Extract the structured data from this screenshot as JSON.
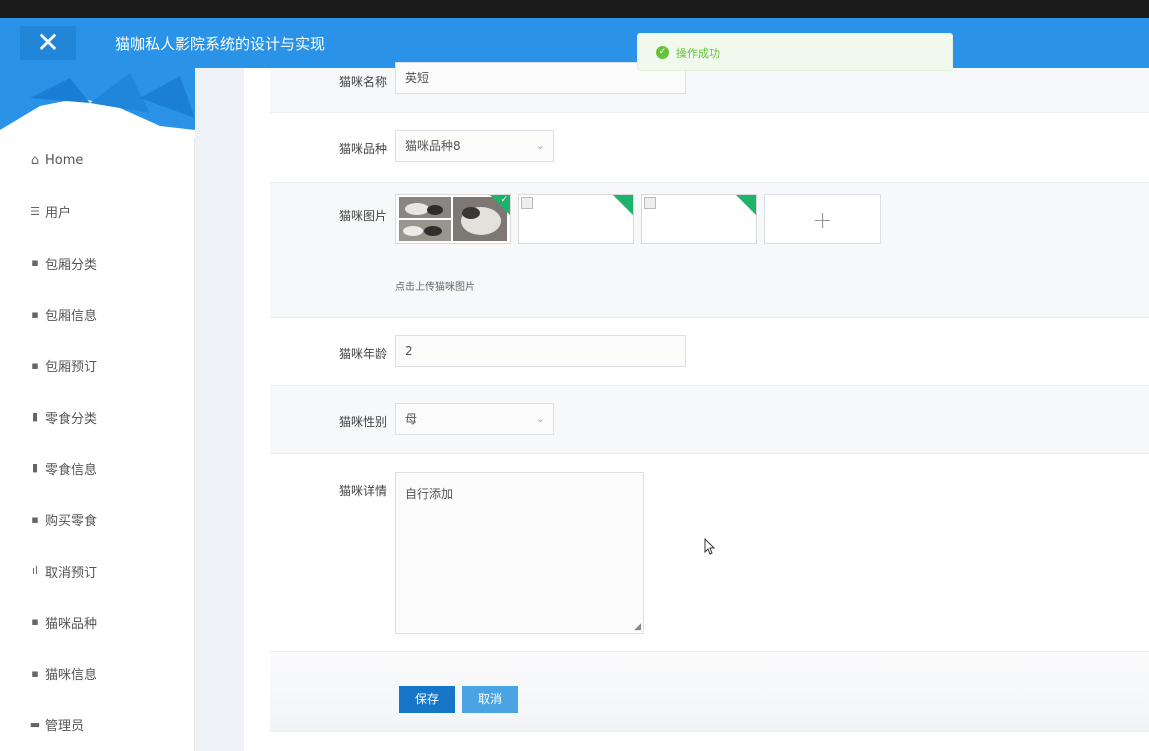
{
  "header": {
    "close_glyph": "✕",
    "title": "猫咖私人影院系统的设计与实现"
  },
  "toast": {
    "icon": "check-circle-icon",
    "message": "操作成功",
    "color": "#67c23a"
  },
  "sidebar": {
    "items": [
      {
        "icon": "home-icon",
        "glyph": "⌂",
        "label": "Home"
      },
      {
        "icon": "list-icon",
        "glyph": "☰",
        "label": "用户"
      },
      {
        "icon": "grid-icon",
        "glyph": "▪",
        "label": "包厢分类"
      },
      {
        "icon": "grid-icon",
        "glyph": "▪",
        "label": "包厢信息"
      },
      {
        "icon": "grid-icon",
        "glyph": "▪",
        "label": "包厢预订"
      },
      {
        "icon": "chart-icon",
        "glyph": "▮",
        "label": "零食分类"
      },
      {
        "icon": "thumb-icon",
        "glyph": "▮",
        "label": "零食信息"
      },
      {
        "icon": "bag-icon",
        "glyph": "▪",
        "label": "购买零食"
      },
      {
        "icon": "bar-chart-icon",
        "glyph": "ıl",
        "label": "取消预订"
      },
      {
        "icon": "grid-icon",
        "glyph": "▪",
        "label": "猫咪品种"
      },
      {
        "icon": "grid-icon",
        "glyph": "▪",
        "label": "猫咪信息"
      },
      {
        "icon": "monitor-icon",
        "glyph": "▬",
        "label": "管理员"
      }
    ]
  },
  "form": {
    "name": {
      "label": "猫咪名称",
      "value": "英短"
    },
    "breed": {
      "label": "猫咪品种",
      "value": "猫咪品种8"
    },
    "images": {
      "label": "猫咪图片",
      "hint": "点击上传猫咪图片",
      "add_glyph": "+"
    },
    "age": {
      "label": "猫咪年龄",
      "value": "2"
    },
    "gender": {
      "label": "猫咪性别",
      "value": "母"
    },
    "detail": {
      "label": "猫咪详情",
      "value": "自行添加"
    },
    "save_label": "保存",
    "cancel_label": "取消"
  },
  "colors": {
    "header": "#2a93e8",
    "primary_button": "#1677c8",
    "secondary_button": "#4aa3e3",
    "upload_badge": "#1db36a"
  }
}
